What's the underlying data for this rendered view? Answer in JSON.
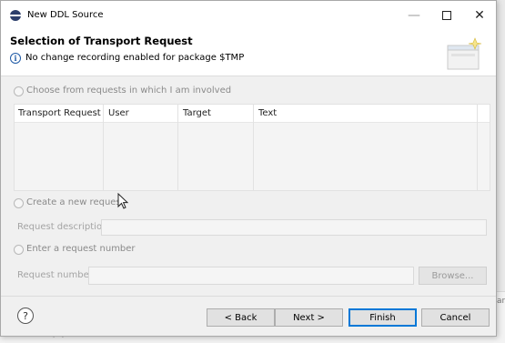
{
  "window": {
    "title": "New DDL Source",
    "minimize": "—",
    "close": "✕"
  },
  "header": {
    "title": "Selection of Transport Request",
    "message": "No change recording enabled for package $TMP"
  },
  "options": {
    "choose_label": "Choose from requests in which I am involved",
    "create_label": "Create a new request",
    "enter_label": "Enter a request number"
  },
  "table": {
    "columns": [
      "Transport Request",
      "User",
      "Target",
      "Text"
    ],
    "rows": []
  },
  "fields": {
    "request_description_label": "Request description:",
    "request_description_value": "",
    "request_number_label": "Request number:",
    "request_number_value": "",
    "browse_label": "Browse..."
  },
  "footer": {
    "help": "?",
    "back": "< Back",
    "next": "Next >",
    "finish": "Finish",
    "cancel": "Cancel"
  },
  "background": {
    "left_text": "s",
    "right_text": "an"
  },
  "colors": {
    "accent": "#0078d7",
    "info": "#1f5aa6"
  }
}
